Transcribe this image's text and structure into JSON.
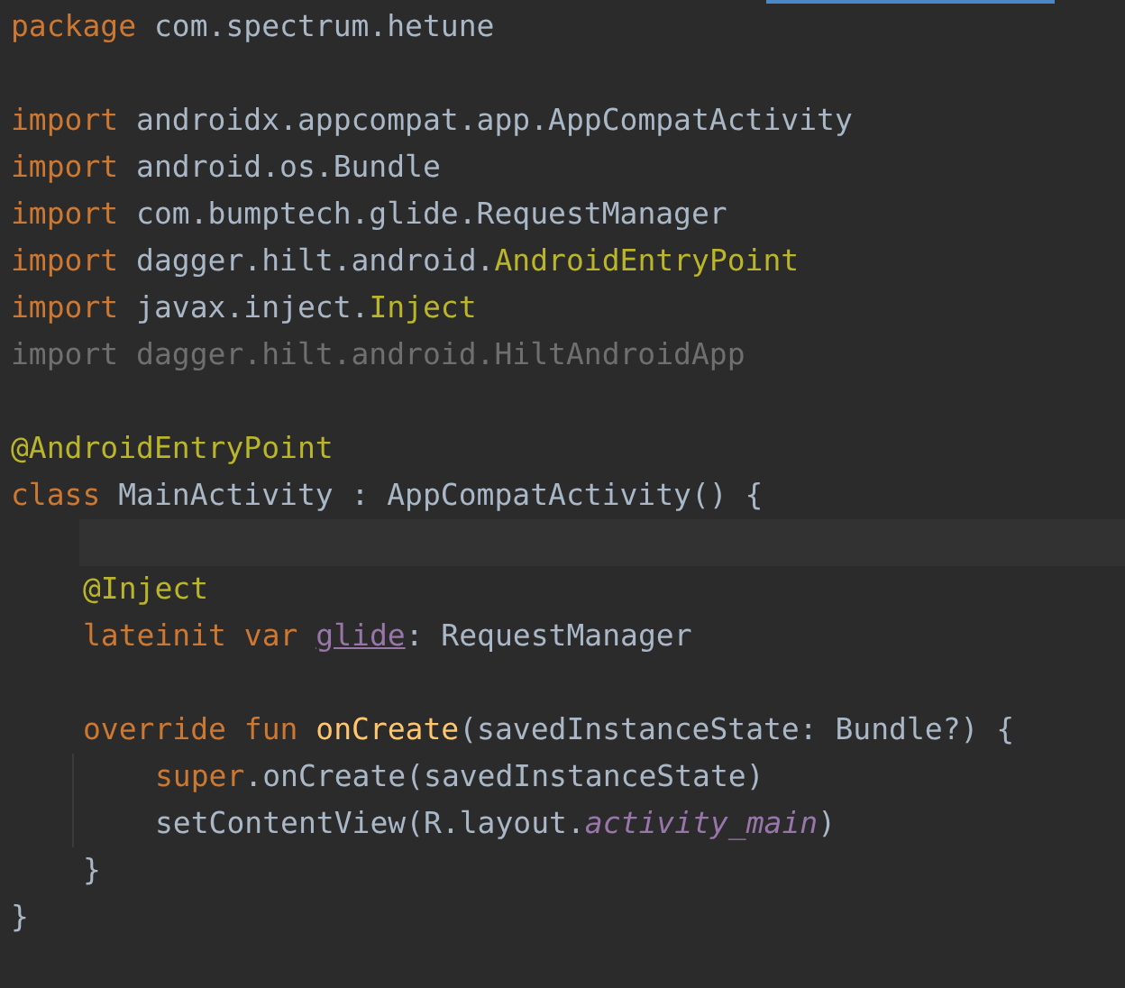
{
  "editor": {
    "lines": [
      {
        "kind": "code",
        "current": false,
        "tokens": [
          {
            "kind": "keyword",
            "text": "package"
          },
          {
            "kind": "plain",
            "text": " com.spectrum.hetune"
          }
        ]
      },
      {
        "kind": "blank",
        "current": false
      },
      {
        "kind": "code",
        "current": false,
        "tokens": [
          {
            "kind": "keyword",
            "text": "import"
          },
          {
            "kind": "plain",
            "text": " androidx.appcompat.app.AppCompatActivity"
          }
        ]
      },
      {
        "kind": "code",
        "current": false,
        "tokens": [
          {
            "kind": "keyword",
            "text": "import"
          },
          {
            "kind": "plain",
            "text": " android.os.Bundle"
          }
        ]
      },
      {
        "kind": "code",
        "current": false,
        "tokens": [
          {
            "kind": "keyword",
            "text": "import"
          },
          {
            "kind": "plain",
            "text": " com.bumptech.glide.RequestManager"
          }
        ]
      },
      {
        "kind": "code",
        "current": false,
        "tokens": [
          {
            "kind": "keyword",
            "text": "import"
          },
          {
            "kind": "plain",
            "text": " dagger.hilt.android."
          },
          {
            "kind": "annotation",
            "text": "AndroidEntryPoint"
          }
        ]
      },
      {
        "kind": "code",
        "current": false,
        "tokens": [
          {
            "kind": "keyword",
            "text": "import"
          },
          {
            "kind": "plain",
            "text": " javax.inject."
          },
          {
            "kind": "annotation",
            "text": "Inject"
          }
        ]
      },
      {
        "kind": "code",
        "current": false,
        "tokens": [
          {
            "kind": "unused",
            "text": "import dagger.hilt.android.HiltAndroidApp"
          }
        ]
      },
      {
        "kind": "blank",
        "current": false
      },
      {
        "kind": "code",
        "current": false,
        "tokens": [
          {
            "kind": "annotation",
            "text": "@AndroidEntryPoint"
          }
        ]
      },
      {
        "kind": "code",
        "current": false,
        "tokens": [
          {
            "kind": "keyword",
            "text": "class"
          },
          {
            "kind": "plain",
            "text": " MainActivity : AppCompatActivity() {"
          }
        ],
        "children": [
          {
            "kind": "blank",
            "current": true
          },
          {
            "kind": "code",
            "current": false,
            "tokens": [
              {
                "kind": "annotation",
                "text": "@Inject"
              }
            ]
          },
          {
            "kind": "code",
            "current": false,
            "tokens": [
              {
                "kind": "keyword",
                "text": "lateinit var "
              },
              {
                "kind": "property",
                "text": "glide"
              },
              {
                "kind": "plain",
                "text": ": RequestManager"
              }
            ]
          },
          {
            "kind": "blank",
            "current": false
          },
          {
            "kind": "code",
            "current": false,
            "tokens": [
              {
                "kind": "keyword",
                "text": "override fun "
              },
              {
                "kind": "function",
                "text": "onCreate"
              },
              {
                "kind": "plain",
                "text": "(savedInstanceState: Bundle?) {"
              }
            ],
            "children": [
              {
                "kind": "code",
                "current": false,
                "tokens": [
                  {
                    "kind": "keyword",
                    "text": "super"
                  },
                  {
                    "kind": "plain",
                    "text": ".onCreate(savedInstanceState)"
                  }
                ]
              },
              {
                "kind": "code",
                "current": false,
                "tokens": [
                  {
                    "kind": "plain",
                    "text": "setContentView(R.layout."
                  },
                  {
                    "kind": "static",
                    "text": "activity_main"
                  },
                  {
                    "kind": "plain",
                    "text": ")"
                  }
                ]
              }
            ]
          },
          {
            "kind": "code",
            "current": false,
            "tokens": [
              {
                "kind": "plain",
                "text": "}"
              }
            ]
          }
        ]
      },
      {
        "kind": "code",
        "current": false,
        "tokens": [
          {
            "kind": "plain",
            "text": "}"
          }
        ]
      }
    ]
  }
}
